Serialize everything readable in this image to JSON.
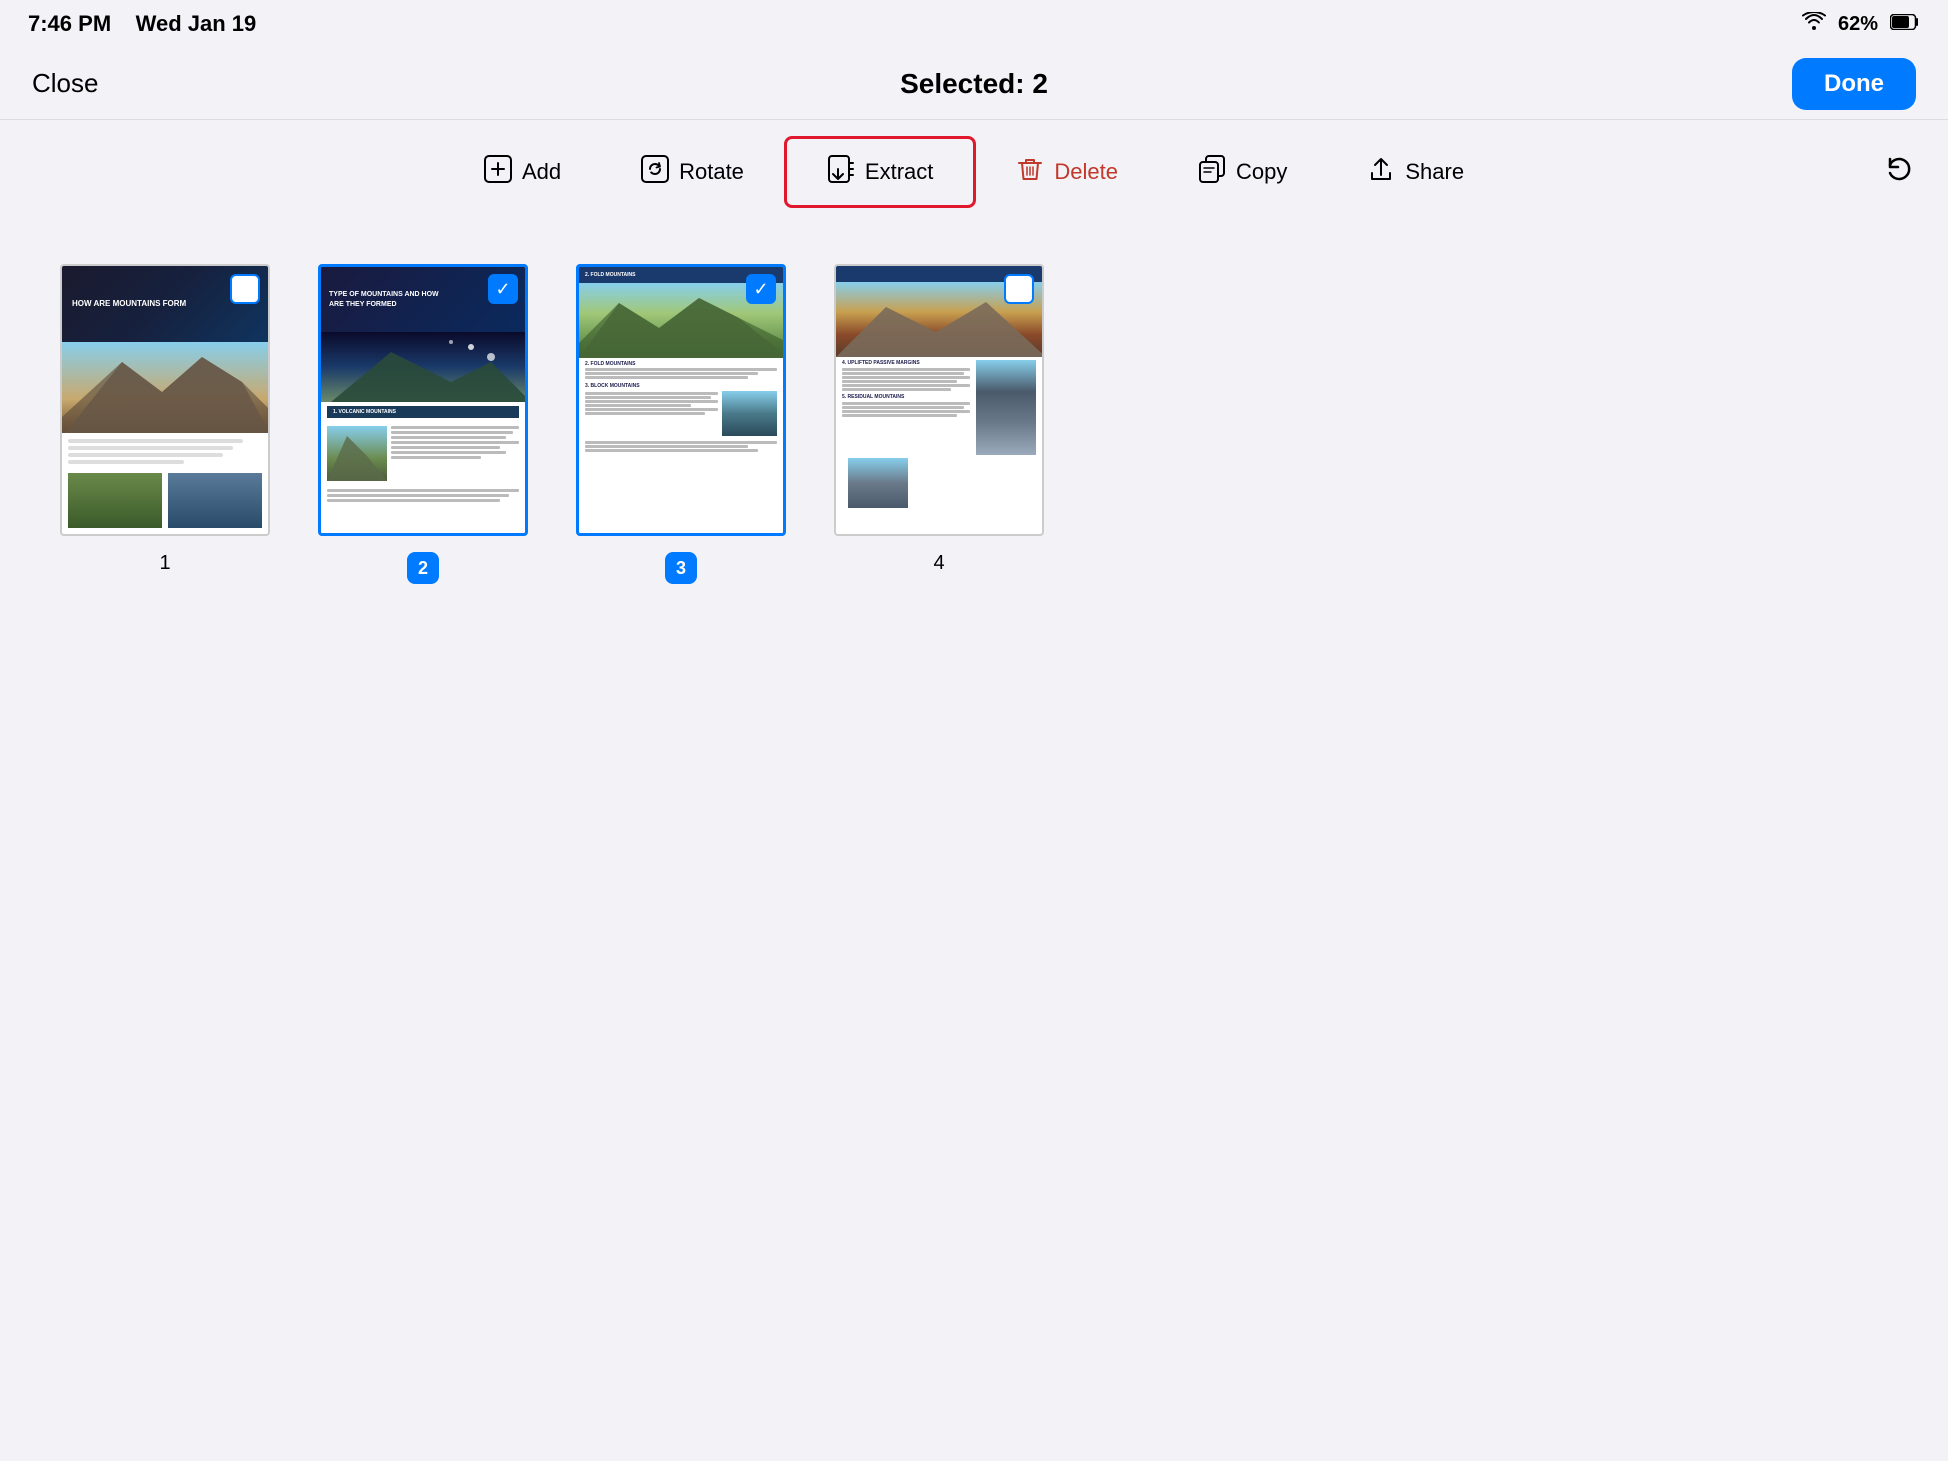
{
  "status_bar": {
    "time": "7:46 PM",
    "date": "Wed Jan 19",
    "wifi": "62%"
  },
  "nav": {
    "close_label": "Close",
    "title": "Selected: 2",
    "done_label": "Done"
  },
  "toolbar": {
    "add_label": "Add",
    "rotate_label": "Rotate",
    "extract_label": "Extract",
    "delete_label": "Delete",
    "copy_label": "Copy",
    "share_label": "Share"
  },
  "pages": [
    {
      "num": "1",
      "label": "1",
      "badge": false,
      "selected": false,
      "checked": false
    },
    {
      "num": "2",
      "label": "2",
      "badge": true,
      "selected": true,
      "checked": true
    },
    {
      "num": "3",
      "label": "3",
      "badge": true,
      "selected": true,
      "checked": true
    },
    {
      "num": "4",
      "label": "4",
      "badge": false,
      "selected": false,
      "checked": false
    }
  ]
}
